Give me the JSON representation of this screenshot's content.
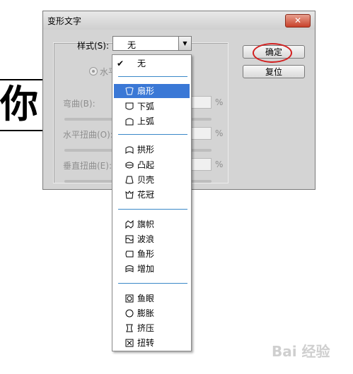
{
  "background": {
    "canvas_text": "你"
  },
  "dialog": {
    "title": "变形文字",
    "close_label": "✕",
    "style_label": "样式(S):",
    "style_value": "无",
    "orientation_label": "水平",
    "bend_label": "弯曲(B):",
    "h_distort_label": "水平扭曲(O):",
    "v_distort_label": "垂直扭曲(E):",
    "percent": "%",
    "ok_label": "确定",
    "reset_label": "复位"
  },
  "menu": {
    "items": [
      {
        "label": "无",
        "icon": "none",
        "checked": true
      },
      {
        "label": "扇形",
        "icon": "arc-icon",
        "selected": true
      },
      {
        "label": "下弧",
        "icon": "arc-lower-icon"
      },
      {
        "label": "上弧",
        "icon": "arc-upper-icon"
      },
      {
        "label": "拱形",
        "icon": "arch-icon"
      },
      {
        "label": "凸起",
        "icon": "bulge-icon"
      },
      {
        "label": "贝壳",
        "icon": "shell-icon"
      },
      {
        "label": "花冠",
        "icon": "flower-icon"
      },
      {
        "label": "旗帜",
        "icon": "flag-icon"
      },
      {
        "label": "波浪",
        "icon": "wave-icon"
      },
      {
        "label": "鱼形",
        "icon": "fish-icon"
      },
      {
        "label": "增加",
        "icon": "rise-icon"
      },
      {
        "label": "鱼眼",
        "icon": "fisheye-icon"
      },
      {
        "label": "膨胀",
        "icon": "inflate-icon"
      },
      {
        "label": "挤压",
        "icon": "squeeze-icon"
      },
      {
        "label": "扭转",
        "icon": "twist-icon"
      }
    ]
  },
  "watermark": "Bai 经验"
}
